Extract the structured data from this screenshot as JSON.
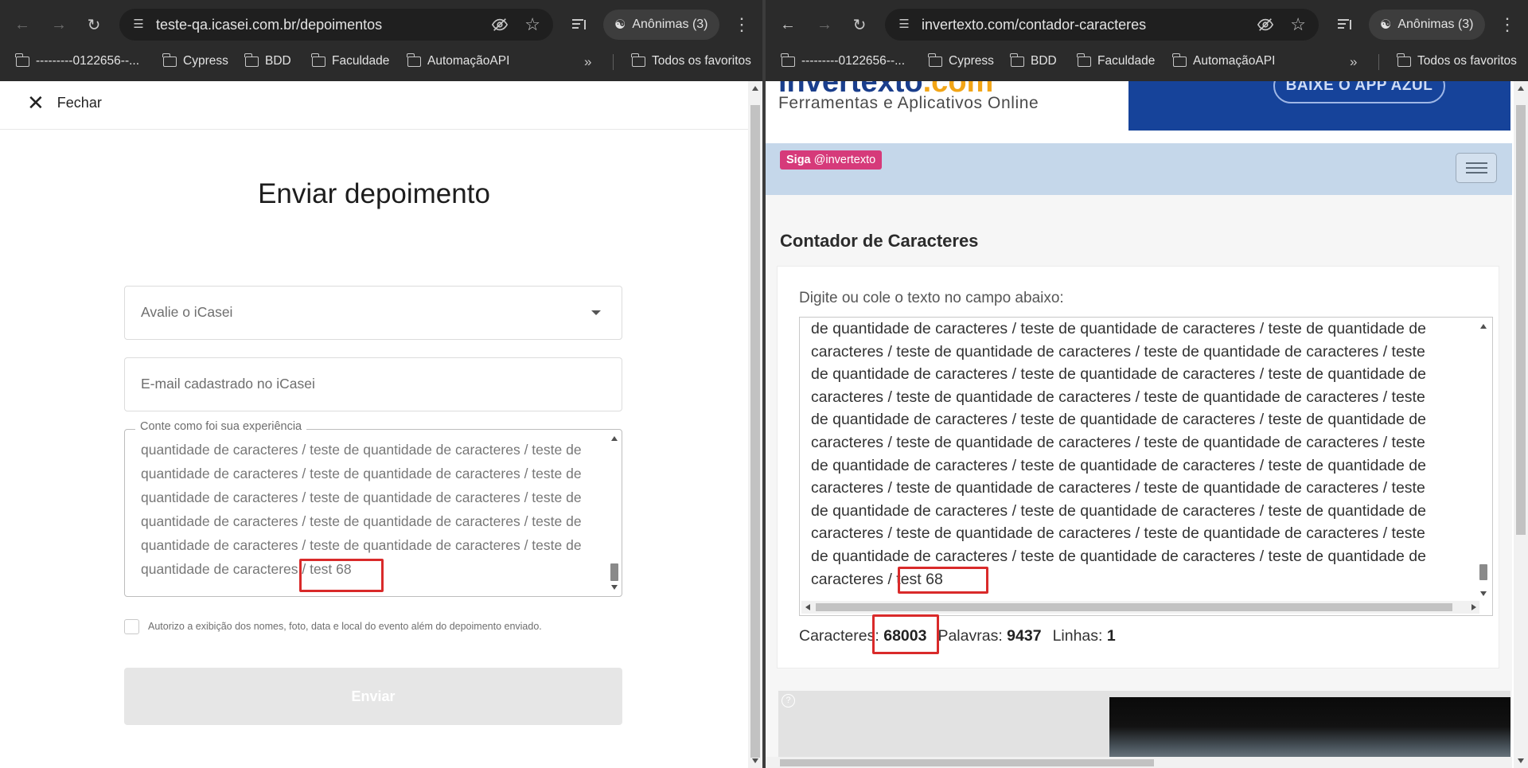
{
  "left_window": {
    "url": "teste-qa.icasei.com.br/depoimentos",
    "incognito_label": "Anônimas (3)",
    "bookmarks": [
      "---------0122656--...",
      "Cypress",
      "BDD",
      "Faculdade",
      "AutomaçãoAPI"
    ],
    "all_bookmarks": "Todos os favoritos",
    "page": {
      "close_label": "Fechar",
      "title": "Enviar depoimento",
      "rating_placeholder": "Avalie o iCasei",
      "email_placeholder": "E-mail cadastrado no iCasei",
      "experience_label": "Conte como foi sua experiência",
      "experience_lines": [
        "quantidade de caracteres / teste de quantidade de caracteres / teste de",
        "quantidade de caracteres / teste de quantidade de caracteres / teste de",
        "quantidade de caracteres / teste de quantidade de caracteres / teste de",
        "quantidade de caracteres / teste de quantidade de caracteres / teste de",
        "quantidade de caracteres / teste de quantidade de caracteres / teste de",
        "quantidade de caracteres / test 68"
      ],
      "consent_label": "Autorizo a exibição dos nomes, foto, data e local do evento além do depoimento enviado.",
      "submit_label": "Enviar"
    }
  },
  "right_window": {
    "url": "invertexto.com/contador-caracteres",
    "incognito_label": "Anônimas (3)",
    "bookmarks": [
      "---------0122656--...",
      "Cypress",
      "BDD",
      "Faculdade",
      "AutomaçãoAPI"
    ],
    "all_bookmarks": "Todos os favoritos",
    "page": {
      "logo_main": "invertexto",
      "logo_suffix": ".com",
      "tagline": "Ferramentas e Aplicativos Online",
      "banner_button": "BAIXE O APP AZUL",
      "follow_prefix": "Siga",
      "follow_handle": "@invertexto",
      "tool_title": "Contador de Caracteres",
      "input_label": "Digite ou cole o texto no campo abaixo:",
      "text_lines": [
        "de quantidade de caracteres / teste de quantidade de caracteres / teste de quantidade de",
        "caracteres / teste de quantidade de caracteres / teste de quantidade de caracteres / teste",
        "de quantidade de caracteres / teste de quantidade de caracteres / teste de quantidade de",
        "caracteres / teste de quantidade de caracteres / teste de quantidade de caracteres / teste",
        "de quantidade de caracteres / teste de quantidade de caracteres / teste de quantidade de",
        "caracteres / teste de quantidade de caracteres / teste de quantidade de caracteres / teste",
        "de quantidade de caracteres / teste de quantidade de caracteres / teste de quantidade de",
        "caracteres / teste de quantidade de caracteres / teste de quantidade de caracteres / teste",
        "de quantidade de caracteres / teste de quantidade de caracteres / teste de quantidade de",
        "caracteres / teste de quantidade de caracteres / teste de quantidade de caracteres / teste",
        "de quantidade de caracteres / teste de quantidade de caracteres / teste de quantidade de",
        "caracteres / test 68"
      ],
      "stats": {
        "chars_label": "Caracteres:",
        "chars_value": "68003",
        "words_label": "Palavras:",
        "words_value": "9437",
        "lines_label": "Linhas:",
        "lines_value": "1"
      },
      "ad_help": "?"
    }
  },
  "colors": {
    "highlight": "#d92a2a",
    "browser_chrome": "#2b2b2b",
    "siga_badge": "#d63a7a",
    "nav_strip": "#c5d7ea",
    "banner": "#16439a"
  }
}
